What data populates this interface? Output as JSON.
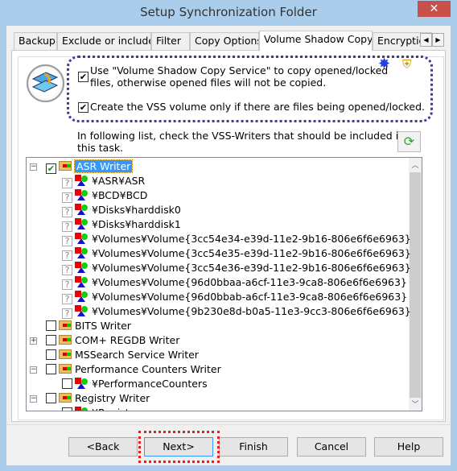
{
  "window": {
    "title": "Setup Synchronization Folder",
    "close": "✕"
  },
  "tabs": [
    {
      "label": "Backup"
    },
    {
      "label": "Exclude or include"
    },
    {
      "label": "Filter"
    },
    {
      "label": "Copy Options"
    },
    {
      "label": "Volume Shadow Copy",
      "active": true
    },
    {
      "label": "Encryption"
    }
  ],
  "tab_scroll": {
    "left": "◀",
    "right": "▶"
  },
  "options": {
    "use_vss": {
      "checked": true,
      "label_line1": "Use \"Volume Shadow Copy Service\" to copy opened/locked",
      "label_line2": "files, otherwise opened files will not be copied."
    },
    "only_if_open": {
      "checked": true,
      "label": "Create the VSS volume only if there are files being opened/locked."
    }
  },
  "instructions": {
    "line1": "In following list, check the VSS-Writers that should be included in",
    "line2": "this task."
  },
  "tree": [
    {
      "label": "ASR Writer",
      "level": 0,
      "type": "writer",
      "expander": "minus",
      "checked": true,
      "selected": true
    },
    {
      "label": "¥ASR¥ASR",
      "level": 1,
      "type": "component",
      "state": "unknown"
    },
    {
      "label": "¥BCD¥BCD",
      "level": 1,
      "type": "component",
      "state": "unknown"
    },
    {
      "label": "¥Disks¥harddisk0",
      "level": 1,
      "type": "component",
      "state": "unknown"
    },
    {
      "label": "¥Disks¥harddisk1",
      "level": 1,
      "type": "component",
      "state": "unknown"
    },
    {
      "label": "¥Volumes¥Volume{3cc54e34-e39d-11e2-9b16-806e6f6e6963}",
      "level": 1,
      "type": "component",
      "state": "unknown"
    },
    {
      "label": "¥Volumes¥Volume{3cc54e35-e39d-11e2-9b16-806e6f6e6963}",
      "level": 1,
      "type": "component",
      "state": "unknown"
    },
    {
      "label": "¥Volumes¥Volume{3cc54e36-e39d-11e2-9b16-806e6f6e6963}",
      "level": 1,
      "type": "component",
      "state": "unknown"
    },
    {
      "label": "¥Volumes¥Volume{96d0bbaa-a6cf-11e3-9ca8-806e6f6e6963}",
      "level": 1,
      "type": "component",
      "state": "unknown"
    },
    {
      "label": "¥Volumes¥Volume{96d0bbab-a6cf-11e3-9ca8-806e6f6e6963}",
      "level": 1,
      "type": "component",
      "state": "unknown"
    },
    {
      "label": "¥Volumes¥Volume{9b230e8d-b0a5-11e3-9cc3-806e6f6e6963}",
      "level": 1,
      "type": "component",
      "state": "unknown"
    },
    {
      "label": "BITS Writer",
      "level": 0,
      "type": "writer",
      "checked": false
    },
    {
      "label": "COM+ REGDB Writer",
      "level": 0,
      "type": "writer",
      "expander": "plus",
      "checked": false
    },
    {
      "label": "MSSearch Service Writer",
      "level": 0,
      "type": "writer",
      "checked": false
    },
    {
      "label": "Performance Counters Writer",
      "level": 0,
      "type": "writer",
      "expander": "minus",
      "checked": false
    },
    {
      "label": "¥PerformanceCounters",
      "level": 1,
      "type": "component",
      "checked": false
    },
    {
      "label": "Registry Writer",
      "level": 0,
      "type": "writer",
      "expander": "minus",
      "checked": false
    },
    {
      "label": "¥Registry",
      "level": 1,
      "type": "component",
      "checked": false
    }
  ],
  "buttons": {
    "back": "<Back",
    "next": "Next>",
    "finish": "Finish",
    "cancel": "Cancel",
    "help": "Help"
  },
  "colors": {
    "selection": "#3399ff",
    "highlight_box": "#e02020",
    "options_box": "#3c3ca0",
    "close": "#c7504b"
  }
}
